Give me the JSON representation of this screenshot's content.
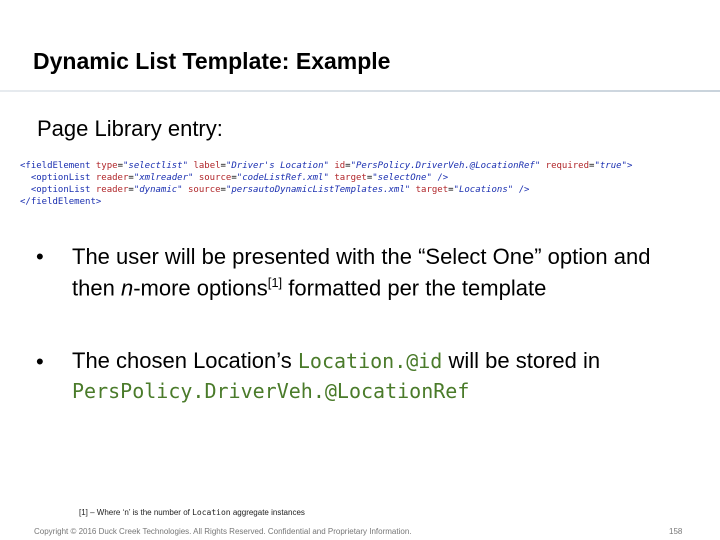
{
  "slide": {
    "title": "Dynamic List Template: Example",
    "subtitle": "Page Library entry:"
  },
  "code": {
    "line1": {
      "open": "<fieldElement",
      "a1": "type",
      "v1": "\"selectlist\"",
      "a2": "label",
      "v2": "\"Driver's Location\"",
      "a3": "id",
      "v3": "\"PersPolicy.DriverVeh.@LocationRef\"",
      "a4": "required",
      "v4": "\"true\"",
      "close": ">"
    },
    "line2": {
      "open": "<optionList",
      "a1": "reader",
      "v1": "\"xmlreader\"",
      "a2": "source",
      "v2": "\"codeListRef.xml\"",
      "a3": "target",
      "v3": "\"selectOne\"",
      "close": "/>"
    },
    "line3": {
      "open": "<optionList",
      "a1": "reader",
      "v1": "\"dynamic\"",
      "a2": "source",
      "v2": "\"persautoDynamicListTemplates.xml\"",
      "a3": "target",
      "v3": "\"Locations\"",
      "close": "/>"
    },
    "line4": "</fieldElement>"
  },
  "bullets": {
    "b1": {
      "marker": "•",
      "p1": "The user will be presented with the “Select One” option and then ",
      "italic": "n",
      "p2": "-more options",
      "sup": "[1]",
      "p3": " formatted per the template"
    },
    "b2": {
      "marker": "•",
      "p1": "The chosen Location’s ",
      "code1": "Location.@id",
      "p2": " will be stored in ",
      "code2": "PersPolicy.DriverVeh.@LocationRef"
    }
  },
  "footnote": {
    "prefix": "[1] – Where ‘n’ is the number of ",
    "code": "Location",
    "suffix": " aggregate instances"
  },
  "footer": {
    "copyright": "Copyright © 2016 Duck Creek Technologies. All Rights Reserved. Confidential and Proprietary Information.",
    "page_number": "158"
  }
}
